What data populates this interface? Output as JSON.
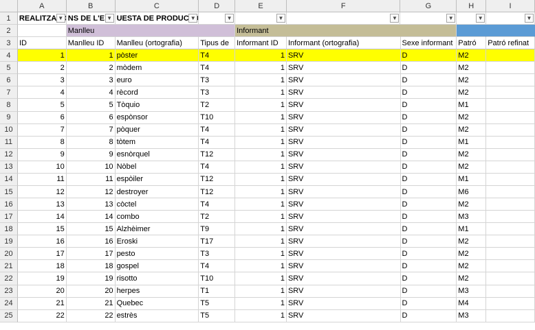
{
  "columns": [
    "A",
    "B",
    "C",
    "D",
    "E",
    "F",
    "G",
    "H",
    "I"
  ],
  "row_numbers": [
    "1",
    "2",
    "3",
    "4",
    "5",
    "6",
    "7",
    "8",
    "9",
    "10",
    "11",
    "12",
    "13",
    "14",
    "15",
    "16",
    "17",
    "18",
    "19",
    "20",
    "21",
    "22",
    "23",
    "24",
    "25"
  ],
  "row1": [
    "REALITZACIÓ",
    "NS DE L'E",
    "UESTA DE PRODUCCIÓ",
    "",
    "",
    "",
    "",
    "",
    ""
  ],
  "row2": {
    "manlleu_group": "Manlleu",
    "informant_group": "Informant",
    "colors": {
      "manlleu": "#d0bfd8",
      "informant": "#c4bd97",
      "blue": "#5b9bd5"
    }
  },
  "headers": [
    "ID",
    "Manlleu ID",
    "Manlleu (ortografia)",
    "Tipus de",
    "Informant ID",
    "Informant (ortografia)",
    "Sexe informant",
    "Patró",
    "Patró refinat"
  ],
  "highlight_color": "#ffff00",
  "rows": [
    [
      "1",
      "1",
      "pòster",
      "T4",
      "1",
      "SRV",
      "D",
      "M2",
      ""
    ],
    [
      "2",
      "2",
      "mòdem",
      "T4",
      "1",
      "SRV",
      "D",
      "M2",
      ""
    ],
    [
      "3",
      "3",
      "euro",
      "T3",
      "1",
      "SRV",
      "D",
      "M2",
      ""
    ],
    [
      "4",
      "4",
      "rècord",
      "T3",
      "1",
      "SRV",
      "D",
      "M2",
      ""
    ],
    [
      "5",
      "5",
      "Tòquio",
      "T2",
      "1",
      "SRV",
      "D",
      "M1",
      ""
    ],
    [
      "6",
      "6",
      "espònsor",
      "T10",
      "1",
      "SRV",
      "D",
      "M2",
      ""
    ],
    [
      "7",
      "7",
      "pòquer",
      "T4",
      "1",
      "SRV",
      "D",
      "M2",
      ""
    ],
    [
      "8",
      "8",
      "tòtem",
      "T4",
      "1",
      "SRV",
      "D",
      "M1",
      ""
    ],
    [
      "9",
      "9",
      "esnòrquel",
      "T12",
      "1",
      "SRV",
      "D",
      "M2",
      ""
    ],
    [
      "10",
      "10",
      "Nòbel",
      "T4",
      "1",
      "SRV",
      "D",
      "M2",
      ""
    ],
    [
      "11",
      "11",
      "espòiler",
      "T12",
      "1",
      "SRV",
      "D",
      "M1",
      ""
    ],
    [
      "12",
      "12",
      "destroyer",
      "T12",
      "1",
      "SRV",
      "D",
      "M6",
      ""
    ],
    [
      "13",
      "13",
      "còctel",
      "T4",
      "1",
      "SRV",
      "D",
      "M2",
      ""
    ],
    [
      "14",
      "14",
      "combo",
      "T2",
      "1",
      "SRV",
      "D",
      "M3",
      ""
    ],
    [
      "15",
      "15",
      "Alzhèimer",
      "T9",
      "1",
      "SRV",
      "D",
      "M1",
      ""
    ],
    [
      "16",
      "16",
      "Eroski",
      "T17",
      "1",
      "SRV",
      "D",
      "M2",
      ""
    ],
    [
      "17",
      "17",
      "pesto",
      "T3",
      "1",
      "SRV",
      "D",
      "M2",
      ""
    ],
    [
      "18",
      "18",
      "gospel",
      "T4",
      "1",
      "SRV",
      "D",
      "M2",
      ""
    ],
    [
      "19",
      "19",
      "risotto",
      "T10",
      "1",
      "SRV",
      "D",
      "M2",
      ""
    ],
    [
      "20",
      "20",
      "herpes",
      "T1",
      "1",
      "SRV",
      "D",
      "M3",
      ""
    ],
    [
      "21",
      "21",
      "Quebec",
      "T5",
      "1",
      "SRV",
      "D",
      "M4",
      ""
    ],
    [
      "22",
      "22",
      "estrès",
      "T5",
      "1",
      "SRV",
      "D",
      "M3",
      ""
    ]
  ]
}
